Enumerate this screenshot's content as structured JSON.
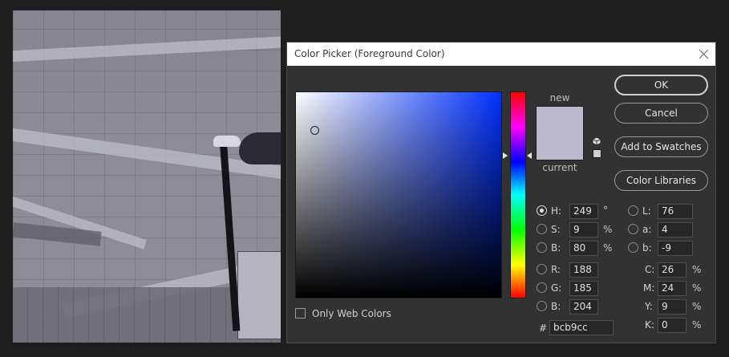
{
  "dialog": {
    "title": "Color Picker (Foreground Color)",
    "buttons": {
      "ok": "OK",
      "cancel": "Cancel",
      "add_to_swatches": "Add to Swatches",
      "color_libraries": "Color Libraries"
    },
    "swatch": {
      "new_label": "new",
      "current_label": "current",
      "color": "#bcb9cc"
    },
    "only_web_colors": "Only Web Colors",
    "fields": {
      "H": {
        "label": "H:",
        "value": "249",
        "unit": "°",
        "selected": true
      },
      "S": {
        "label": "S:",
        "value": "9",
        "unit": "%"
      },
      "Bv": {
        "label": "B:",
        "value": "80",
        "unit": "%"
      },
      "R": {
        "label": "R:",
        "value": "188"
      },
      "G": {
        "label": "G:",
        "value": "185"
      },
      "Bc": {
        "label": "B:",
        "value": "204"
      },
      "L": {
        "label": "L:",
        "value": "76"
      },
      "a": {
        "label": "a:",
        "value": "4"
      },
      "b": {
        "label": "b:",
        "value": "-9"
      },
      "C": {
        "label": "C:",
        "value": "26",
        "unit": "%"
      },
      "M": {
        "label": "M:",
        "value": "24",
        "unit": "%"
      },
      "Y": {
        "label": "Y:",
        "value": "9",
        "unit": "%"
      },
      "K": {
        "label": "K:",
        "value": "0",
        "unit": "%"
      },
      "hex": {
        "label": "#",
        "value": "bcb9cc"
      }
    },
    "icons": {
      "close": "close-icon",
      "cube": "cube-icon",
      "websafe": "websafe-swatch-icon"
    }
  },
  "background_image": {
    "icon": "photo-canvas"
  }
}
